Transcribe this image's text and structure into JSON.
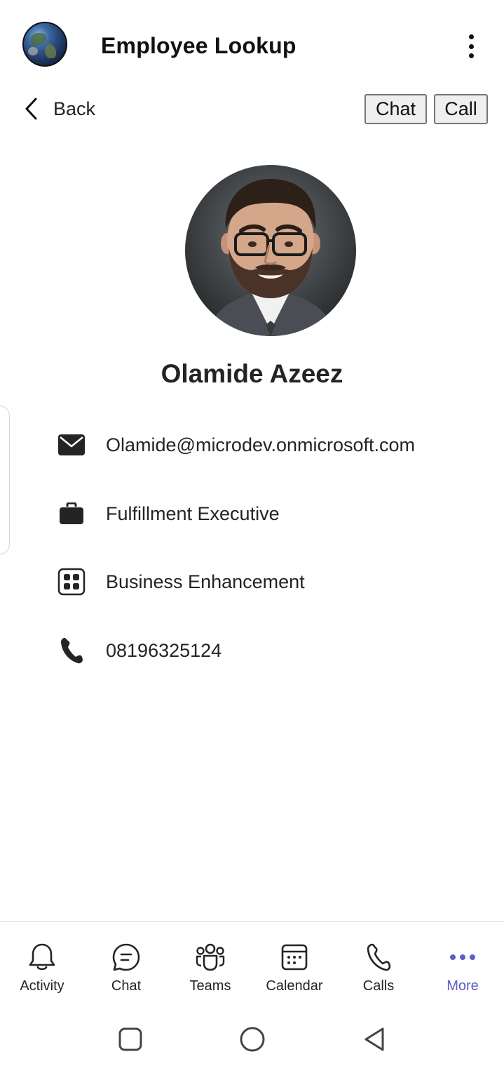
{
  "header": {
    "title": "Employee Lookup",
    "logo_icon": "globe-icon",
    "menu_icon": "more-vertical-icon"
  },
  "toolbar": {
    "back_label": "Back",
    "chat_label": "Chat",
    "call_label": "Call"
  },
  "profile": {
    "name": "Olamide Azeez",
    "email": "Olamide@microdev.onmicrosoft.com",
    "job_title": "Fulfillment Executive",
    "department": "Business Enhancement",
    "phone": "08196325124"
  },
  "bottom_nav": {
    "items": [
      {
        "label": "Activity",
        "icon": "bell-icon"
      },
      {
        "label": "Chat",
        "icon": "chat-icon"
      },
      {
        "label": "Teams",
        "icon": "teams-icon"
      },
      {
        "label": "Calendar",
        "icon": "calendar-icon"
      },
      {
        "label": "Calls",
        "icon": "phone-icon"
      },
      {
        "label": "More",
        "icon": "more-horizontal-icon"
      }
    ],
    "active": "More"
  },
  "colors": {
    "accent": "#5b5fc7",
    "text": "#242424",
    "button_bg": "#efefef",
    "button_border": "#767676"
  }
}
